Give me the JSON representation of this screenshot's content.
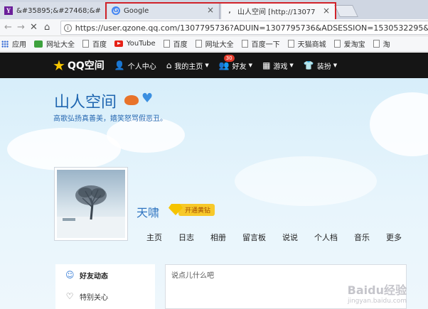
{
  "browser": {
    "tabs": [
      {
        "label": "&#35895;&#27468;&#",
        "favicon": "Y",
        "favicon_color": "#6b1f9a"
      },
      {
        "label": "Google",
        "favicon": "G",
        "favicon_color": "#4285f4"
      },
      {
        "label": "山人空间 [http://13077",
        "favicon": "‚"
      }
    ],
    "tab_close_glyph": "×",
    "highlight_color": "#d1232a",
    "url": "https://user.qzone.qq.com/1307795736?ADUIN=1307795736&ADSESSION=1530532295&",
    "bookmarks": [
      {
        "label": "应用",
        "icon": "apps-icon"
      },
      {
        "label": "网址大全",
        "icon": "hao123-icon"
      },
      {
        "label": "百度",
        "icon": "page-icon"
      },
      {
        "label": "YouTube",
        "icon": "youtube-icon"
      },
      {
        "label": "百度",
        "icon": "page-icon"
      },
      {
        "label": "网址大全",
        "icon": "page-icon"
      },
      {
        "label": "百度一下",
        "icon": "page-icon"
      },
      {
        "label": "天猫商城",
        "icon": "page-icon"
      },
      {
        "label": "爱淘宝",
        "icon": "page-icon"
      },
      {
        "label": "淘",
        "icon": "page-icon"
      }
    ]
  },
  "qznav": {
    "logo_text": "QQ空间",
    "items": [
      {
        "label": "个人中心",
        "icon": "person-icon"
      },
      {
        "label": "我的主页",
        "icon": "home-icon"
      },
      {
        "label": "好友",
        "icon": "friends-icon",
        "badge": "30"
      },
      {
        "label": "游戏",
        "icon": "games-icon"
      },
      {
        "label": "装扮",
        "icon": "shirt-icon"
      }
    ]
  },
  "profile": {
    "space_title": "山人空间",
    "motto": "高歌弘扬真善美，嬉笑怒骂假恶丑。",
    "username": "天啸",
    "vip_label": "开通黄钻",
    "tabs": [
      "主页",
      "日志",
      "相册",
      "留言板",
      "说说",
      "个人档",
      "音乐",
      "更多"
    ]
  },
  "feed": {
    "items": [
      {
        "label": "好友动态",
        "icon": "friends-icon",
        "active": true
      },
      {
        "label": "特别关心",
        "icon": "heart-icon",
        "active": false
      }
    ],
    "composer_placeholder": "说点儿什么吧"
  },
  "watermark": {
    "main": "Baidu经验",
    "sub": "jingyan.baidu.com"
  }
}
